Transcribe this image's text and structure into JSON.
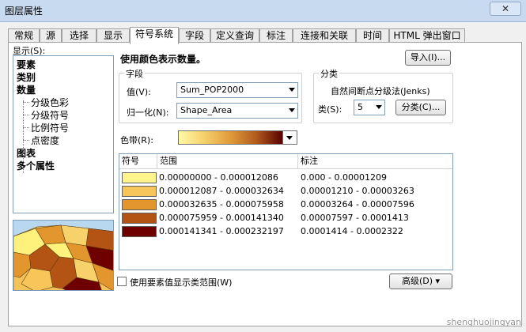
{
  "window": {
    "title": "图层属性",
    "close_label": "✕"
  },
  "tabs": [
    {
      "label": "常规"
    },
    {
      "label": "源"
    },
    {
      "label": "选择"
    },
    {
      "label": "显示"
    },
    {
      "label": "符号系统"
    },
    {
      "label": "字段"
    },
    {
      "label": "定义查询"
    },
    {
      "label": "标注"
    },
    {
      "label": "连接和关联"
    },
    {
      "label": "时间"
    },
    {
      "label": "HTML 弹出窗口"
    }
  ],
  "active_tab": "符号系统",
  "show_label": "显示(S):",
  "tree": {
    "items": [
      {
        "label": "要素",
        "level": 0
      },
      {
        "label": "类别",
        "level": 0
      },
      {
        "label": "数量",
        "level": 0
      },
      {
        "label": "分级色彩",
        "level": 1
      },
      {
        "label": "分级符号",
        "level": 1
      },
      {
        "label": "比例符号",
        "level": 1
      },
      {
        "label": "点密度",
        "level": 1
      },
      {
        "label": "图表",
        "level": 0
      },
      {
        "label": "多个属性",
        "level": 0
      }
    ]
  },
  "heading": "使用颜色表示数量。",
  "import_button": "导入(I)...",
  "fields": {
    "title": "字段",
    "value_label": "值(V):",
    "value": "Sum_POP2000",
    "normalize_label": "归一化(N):",
    "normalize": "Shape_Area"
  },
  "classification": {
    "title": "分类",
    "method": "自然间断点分级法(Jenks)",
    "classes_label": "类(S):",
    "classes": "5",
    "classify_button": "分类(C)..."
  },
  "ramp_label": "色带(R):",
  "table": {
    "headers": [
      "符号",
      "范围",
      "标注"
    ],
    "rows": [
      {
        "color": "#fff58c",
        "range": "0.00000000 - 0.000012086",
        "label": "0.000 - 0.00001209"
      },
      {
        "color": "#f7c55a",
        "range": "0.000012087 - 0.000032634",
        "label": "0.00001210 - 0.00003263"
      },
      {
        "color": "#e3962e",
        "range": "0.000032635 - 0.000075958",
        "label": "0.00003264 - 0.00007596"
      },
      {
        "color": "#b35414",
        "range": "0.000075959 - 0.000141340",
        "label": "0.00007597 - 0.0001413"
      },
      {
        "color": "#6e0000",
        "range": "0.000141341 - 0.000232197",
        "label": "0.0001414 - 0.0002322"
      }
    ]
  },
  "checkbox_label": "使用要素值显示类范围(W)",
  "advanced_button": "高级(D)",
  "watermark": "shenghuojingyan"
}
